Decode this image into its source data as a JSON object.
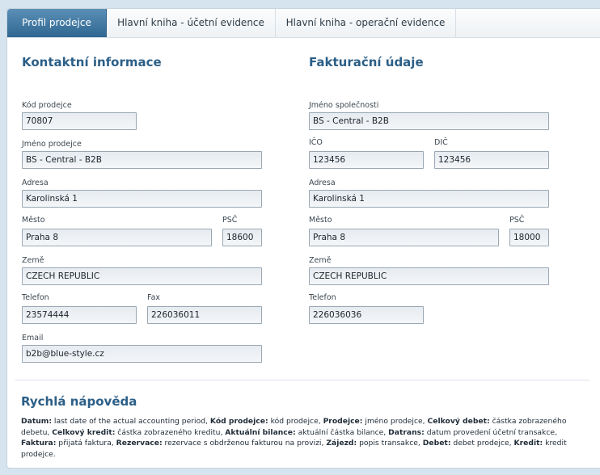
{
  "tabs": [
    {
      "label": "Profil prodejce",
      "active": true
    },
    {
      "label": "Hlavní kniha - účetní evidence",
      "active": false
    },
    {
      "label": "Hlavní kniha - operační evidence",
      "active": false
    }
  ],
  "contact": {
    "title": "Kontaktní informace",
    "seller_code": {
      "label": "Kód prodejce",
      "value": "70807"
    },
    "seller_name": {
      "label": "Jméno prodejce",
      "value": "BS - Central - B2B"
    },
    "address": {
      "label": "Adresa",
      "value": "Karolinská 1"
    },
    "city": {
      "label": "Město",
      "value": "Praha 8"
    },
    "zip": {
      "label": "PSČ",
      "value": "18600"
    },
    "country": {
      "label": "Země",
      "value": "CZECH REPUBLIC"
    },
    "phone": {
      "label": "Telefon",
      "value": "23574444"
    },
    "fax": {
      "label": "Fax",
      "value": "226036011"
    },
    "email": {
      "label": "Email",
      "value": "b2b@blue-style.cz"
    }
  },
  "billing": {
    "title": "Fakturační údaje",
    "company": {
      "label": "Jméno společnosti",
      "value": "BS - Central - B2B"
    },
    "ico": {
      "label": "IČO",
      "value": "123456"
    },
    "dic": {
      "label": "DIČ",
      "value": "123456"
    },
    "address": {
      "label": "Adresa",
      "value": "Karolinská 1"
    },
    "city": {
      "label": "Město",
      "value": "Praha 8"
    },
    "zip": {
      "label": "PSČ",
      "value": "18000"
    },
    "country": {
      "label": "Země",
      "value": "CZECH REPUBLIC"
    },
    "phone": {
      "label": "Telefon",
      "value": "226036036"
    }
  },
  "help": {
    "title": "Rychlá nápověda",
    "items": [
      {
        "term": "Datum:",
        "desc": " last date of the actual accounting period, "
      },
      {
        "term": "Kód prodejce:",
        "desc": " kód prodejce, "
      },
      {
        "term": "Prodejce:",
        "desc": " jméno prodejce, "
      },
      {
        "term": "Celkový debet:",
        "desc": " částka zobrazeného debetu, "
      },
      {
        "term": "Celkový kredit:",
        "desc": " částka zobrazeného kreditu, "
      },
      {
        "term": "Aktuální bilance:",
        "desc": " aktuální částka bilance, "
      },
      {
        "term": "Datrans:",
        "desc": " datum provedení účetní transakce, "
      },
      {
        "term": "Faktura:",
        "desc": " přijatá faktura, "
      },
      {
        "term": "Rezervace:",
        "desc": " rezervace s obdrženou fakturou na provizi, "
      },
      {
        "term": "Zájezd:",
        "desc": " popis transakce, "
      },
      {
        "term": "Debet:",
        "desc": " debet prodejce, "
      },
      {
        "term": "Kredit:",
        "desc": " kredit prodejce."
      }
    ]
  },
  "colors": {
    "accent": "#2c5f87",
    "tab_active": "#3f77a2",
    "background": "#d6e4ef"
  }
}
